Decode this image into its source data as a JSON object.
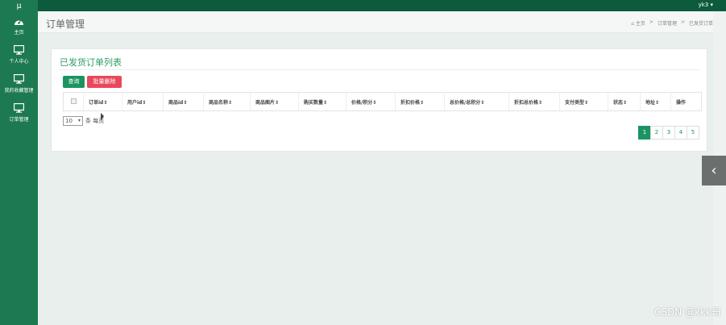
{
  "sidebar": {
    "logo": "μ",
    "items": [
      {
        "label": "主页",
        "icon": "dashboard-icon"
      },
      {
        "label": "个人中心",
        "icon": "monitor-icon"
      },
      {
        "label": "我的收藏管理",
        "icon": "monitor-icon"
      },
      {
        "label": "订单管理",
        "icon": "monitor-icon"
      }
    ]
  },
  "topbar": {
    "user": "yk3 ▾"
  },
  "header": {
    "title": "订单管理",
    "breadcrumb": [
      "⌂ 主页",
      ">",
      "订单管理",
      ">",
      "已发货订单"
    ]
  },
  "card": {
    "title": "已发货订单列表",
    "search_label": "查询",
    "delete_label": "批量删除",
    "columns": [
      "订单id⇕",
      "用户id⇕",
      "商品id⇕",
      "商品名称⇕",
      "商品图片⇕",
      "购买数量⇕",
      "价格/积分⇕",
      "折扣价格⇕",
      "总价格/总积分⇕",
      "折扣总价格⇕",
      "支付类型⇕",
      "状态⇕",
      "地址⇕",
      "操作"
    ],
    "page_size": "10",
    "page_size_suffix": "条 每页",
    "pages": [
      "1",
      "2",
      "3",
      "4",
      "5"
    ],
    "active_page": "1"
  },
  "colors": {
    "sidebar": "#1d7a50",
    "topbar": "#0c5b3c",
    "accent": "#1b9462",
    "danger": "#e9485c"
  },
  "watermark": "CSDN @kkk哥"
}
